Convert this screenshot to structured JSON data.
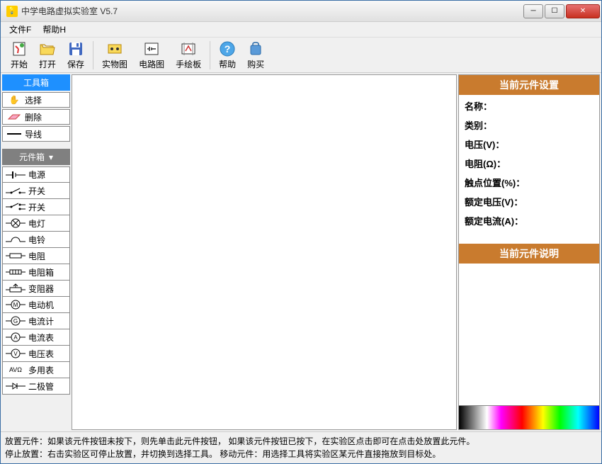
{
  "window": {
    "title": "中学电路虚拟实验室 V5.7"
  },
  "menu": {
    "file": "文件F",
    "help": "帮助H"
  },
  "toolbar": {
    "start": "开始",
    "open": "打开",
    "save": "保存",
    "physical": "实物图",
    "circuit": "电路图",
    "sketch": "手绘板",
    "help": "帮助",
    "buy": "购买"
  },
  "toolbox": {
    "header": "工具箱",
    "select": "选择",
    "delete": "删除",
    "wire": "导线"
  },
  "componentbox": {
    "header": "元件箱",
    "items": [
      {
        "label": "电源"
      },
      {
        "label": "开关"
      },
      {
        "label": "开关"
      },
      {
        "label": "电灯"
      },
      {
        "label": "电铃"
      },
      {
        "label": "电阻"
      },
      {
        "label": "电阻箱"
      },
      {
        "label": "变阻器"
      },
      {
        "label": "电动机"
      },
      {
        "label": "电流计"
      },
      {
        "label": "电流表"
      },
      {
        "label": "电压表"
      },
      {
        "label": "多用表"
      },
      {
        "label": "二极管"
      }
    ]
  },
  "properties": {
    "header": "当前元件设置",
    "name": "名称：",
    "category": "类别：",
    "voltage": "电压(V)：",
    "resistance": "电阻(Ω)：",
    "contact": "触点位置(%)：",
    "rated_voltage": "额定电压(V)：",
    "rated_current": "额定电流(A)："
  },
  "description": {
    "header": "当前元件说明"
  },
  "status": {
    "line1": "放置元件：如果该元件按钮未按下，则先单击此元件按钮， 如果该元件按钮已按下，在实验区点击即可在点击处放置此元件。",
    "line2": "停止放置：右击实验区可停止放置，并切换到选择工具。   移动元件：用选择工具将实验区某元件直接拖放到目标处。"
  }
}
